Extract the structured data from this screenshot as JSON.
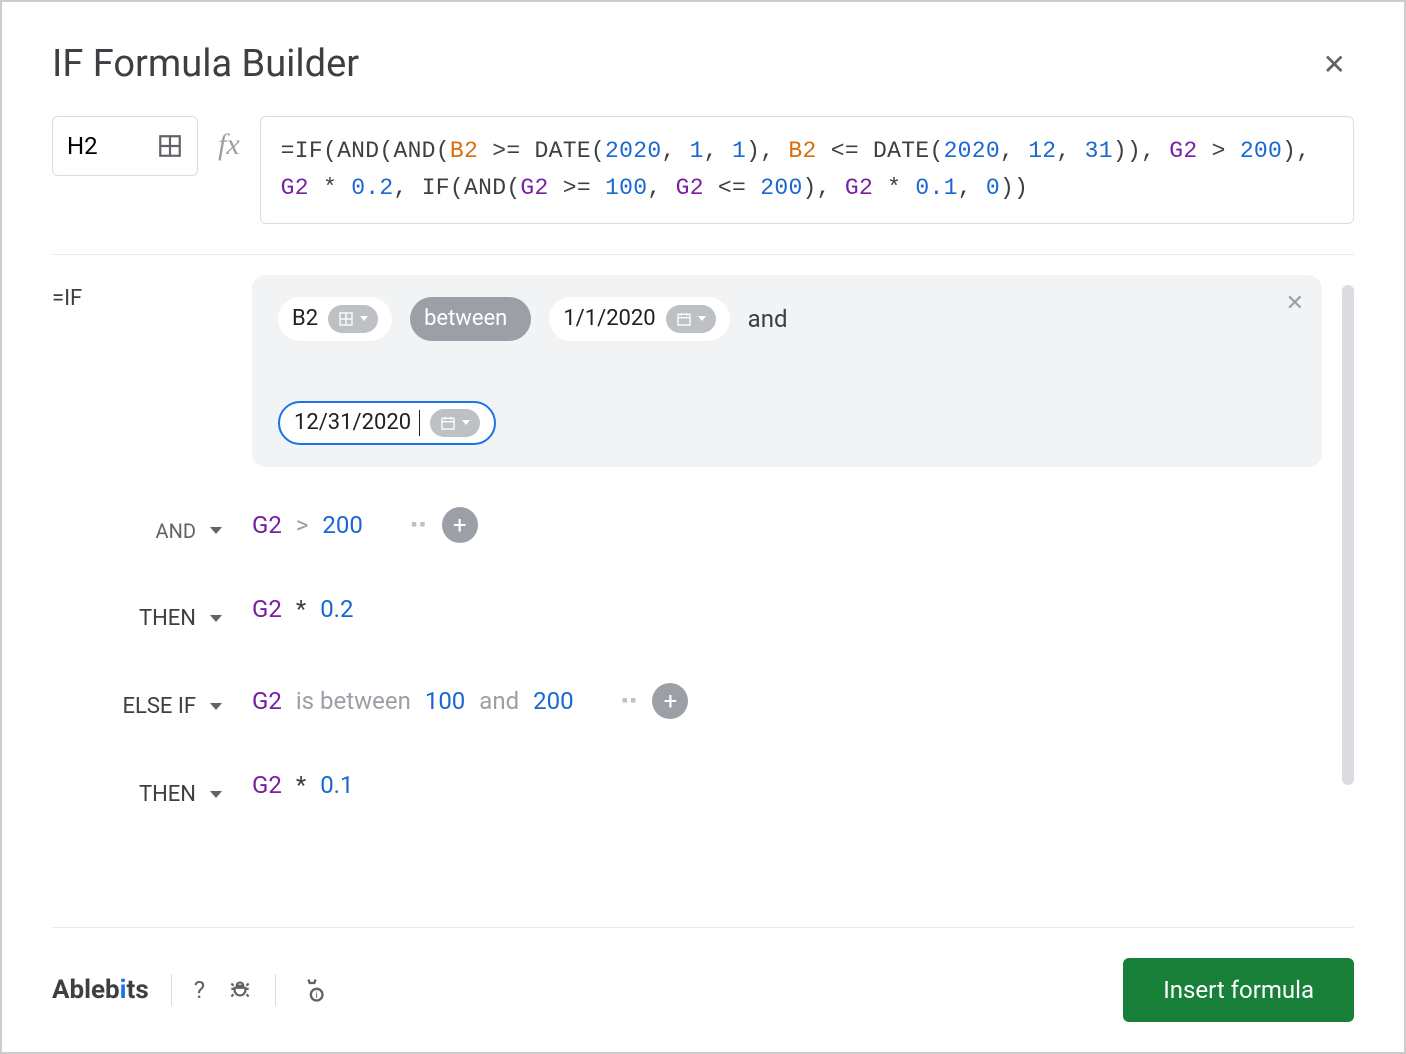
{
  "header": {
    "title": "IF Formula Builder"
  },
  "cell_ref": "H2",
  "formula_tokens": [
    {
      "t": "=IF(AND(AND(",
      "c": "op"
    },
    {
      "t": "B2",
      "c": "cellB"
    },
    {
      "t": " >= DATE(",
      "c": "op"
    },
    {
      "t": "2020",
      "c": "num"
    },
    {
      "t": ", ",
      "c": "op"
    },
    {
      "t": "1",
      "c": "num"
    },
    {
      "t": ", ",
      "c": "op"
    },
    {
      "t": "1",
      "c": "num"
    },
    {
      "t": "), ",
      "c": "op"
    },
    {
      "t": "B2",
      "c": "cellB"
    },
    {
      "t": " <= DATE(",
      "c": "op"
    },
    {
      "t": "2020",
      "c": "num"
    },
    {
      "t": ", ",
      "c": "op"
    },
    {
      "t": "12",
      "c": "num"
    },
    {
      "t": ", ",
      "c": "op"
    },
    {
      "t": "31",
      "c": "num"
    },
    {
      "t": ")), ",
      "c": "op"
    },
    {
      "t": "G2",
      "c": "ref"
    },
    {
      "t": " > ",
      "c": "op"
    },
    {
      "t": "200",
      "c": "num"
    },
    {
      "t": "), ",
      "c": "op"
    },
    {
      "t": "G2",
      "c": "ref"
    },
    {
      "t": " * ",
      "c": "op"
    },
    {
      "t": "0.2",
      "c": "num"
    },
    {
      "t": ", IF(AND(",
      "c": "op"
    },
    {
      "t": "G2",
      "c": "ref"
    },
    {
      "t": " >= ",
      "c": "op"
    },
    {
      "t": "100",
      "c": "num"
    },
    {
      "t": ", ",
      "c": "op"
    },
    {
      "t": "G2",
      "c": "ref"
    },
    {
      "t": " <= ",
      "c": "op"
    },
    {
      "t": "200",
      "c": "num"
    },
    {
      "t": "), ",
      "c": "op"
    },
    {
      "t": "G2",
      "c": "ref"
    },
    {
      "t": " * ",
      "c": "op"
    },
    {
      "t": "0.1",
      "c": "num"
    },
    {
      "t": ", ",
      "c": "op"
    },
    {
      "t": "0",
      "c": "num"
    },
    {
      "t": "))",
      "c": "op"
    }
  ],
  "rules": {
    "if_label": "=IF",
    "if_cond": {
      "cell": "B2",
      "operator": "between",
      "date1": "1/1/2020",
      "and": "and",
      "date2": "12/31/2020"
    },
    "and_label": "AND",
    "and_cond": {
      "ref": "G2",
      "op": ">",
      "val": "200"
    },
    "then1_label": "THEN",
    "then1_val": {
      "ref": "G2",
      "op": "*",
      "val": "0.2"
    },
    "elseif_label": "ELSE IF",
    "elseif_cond": {
      "ref": "G2",
      "txt1": "is between",
      "v1": "100",
      "txt2": "and",
      "v2": "200"
    },
    "then2_label": "THEN",
    "then2_val": {
      "ref": "G2",
      "op": "*",
      "val": "0.1"
    }
  },
  "footer": {
    "brand": "Ableb",
    "brand2": "ts",
    "help": "?",
    "insert": "Insert formula"
  }
}
